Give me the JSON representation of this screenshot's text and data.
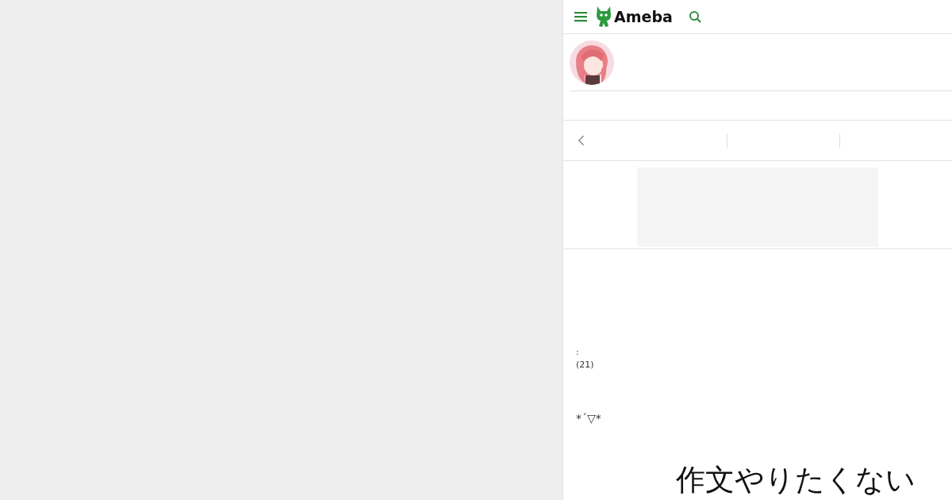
{
  "header": {
    "logo_text": "Ameba"
  },
  "article": {
    "lines": [
      ":",
      "(21)"
    ],
    "emoticon": "*´▽*",
    "headline": "作文やりたくない"
  }
}
